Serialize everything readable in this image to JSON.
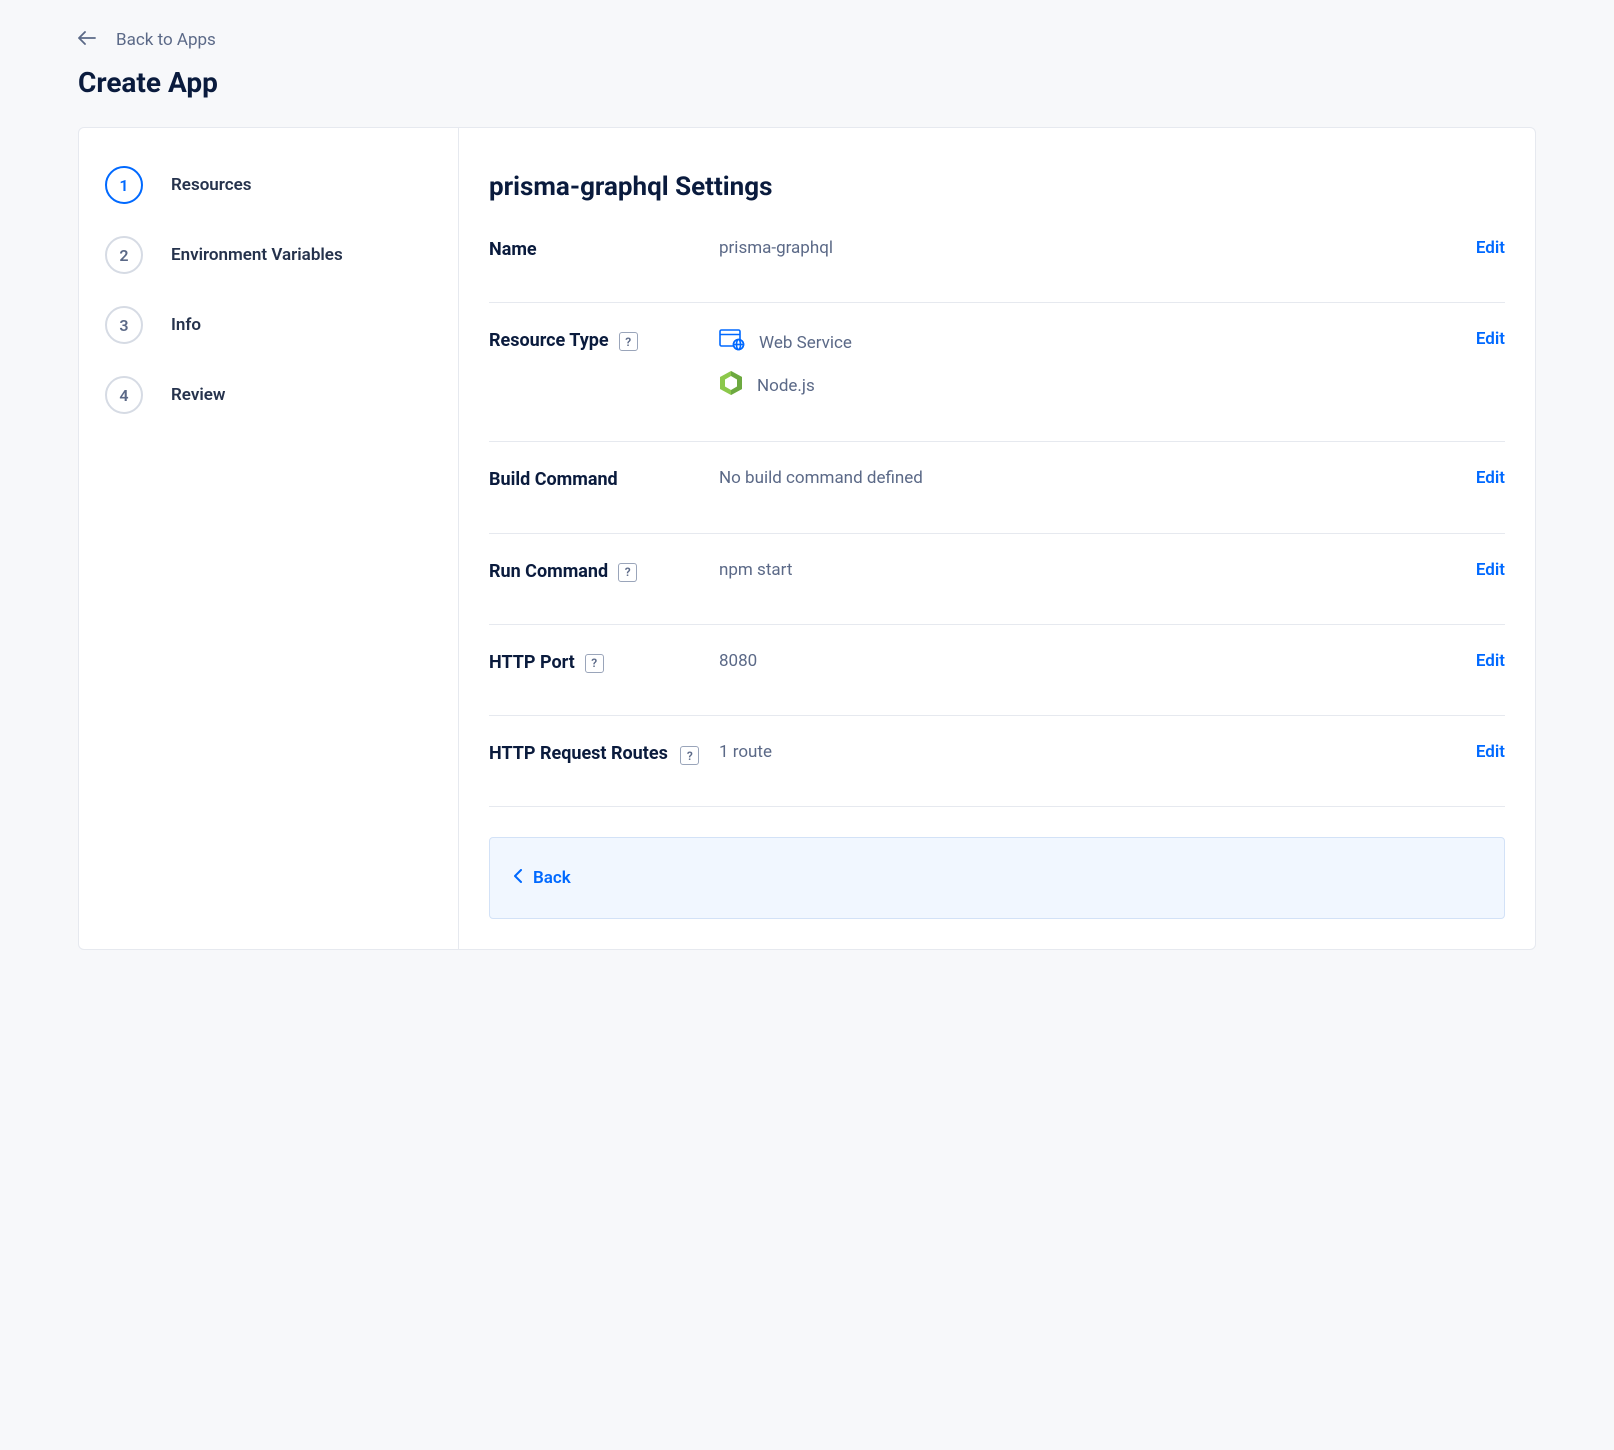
{
  "nav": {
    "back_label": "Back to Apps",
    "page_title": "Create App"
  },
  "steps": [
    {
      "num": "1",
      "label": "Resources",
      "active": true
    },
    {
      "num": "2",
      "label": "Environment Variables",
      "active": false
    },
    {
      "num": "3",
      "label": "Info",
      "active": false
    },
    {
      "num": "4",
      "label": "Review",
      "active": false
    }
  ],
  "section_title": "prisma-graphql Settings",
  "edit_label": "Edit",
  "rows": {
    "name": {
      "label": "Name",
      "value": "prisma-graphql"
    },
    "resource_type": {
      "label": "Resource Type",
      "service": "Web Service",
      "runtime": "Node.js"
    },
    "build_command": {
      "label": "Build Command",
      "value": "No build command defined"
    },
    "run_command": {
      "label": "Run Command",
      "value": "npm start"
    },
    "http_port": {
      "label": "HTTP Port",
      "value": "8080"
    },
    "http_routes": {
      "label": "HTTP Request Routes",
      "value": "1 route"
    }
  },
  "footer": {
    "back_label": "Back"
  },
  "help_glyph": "?"
}
